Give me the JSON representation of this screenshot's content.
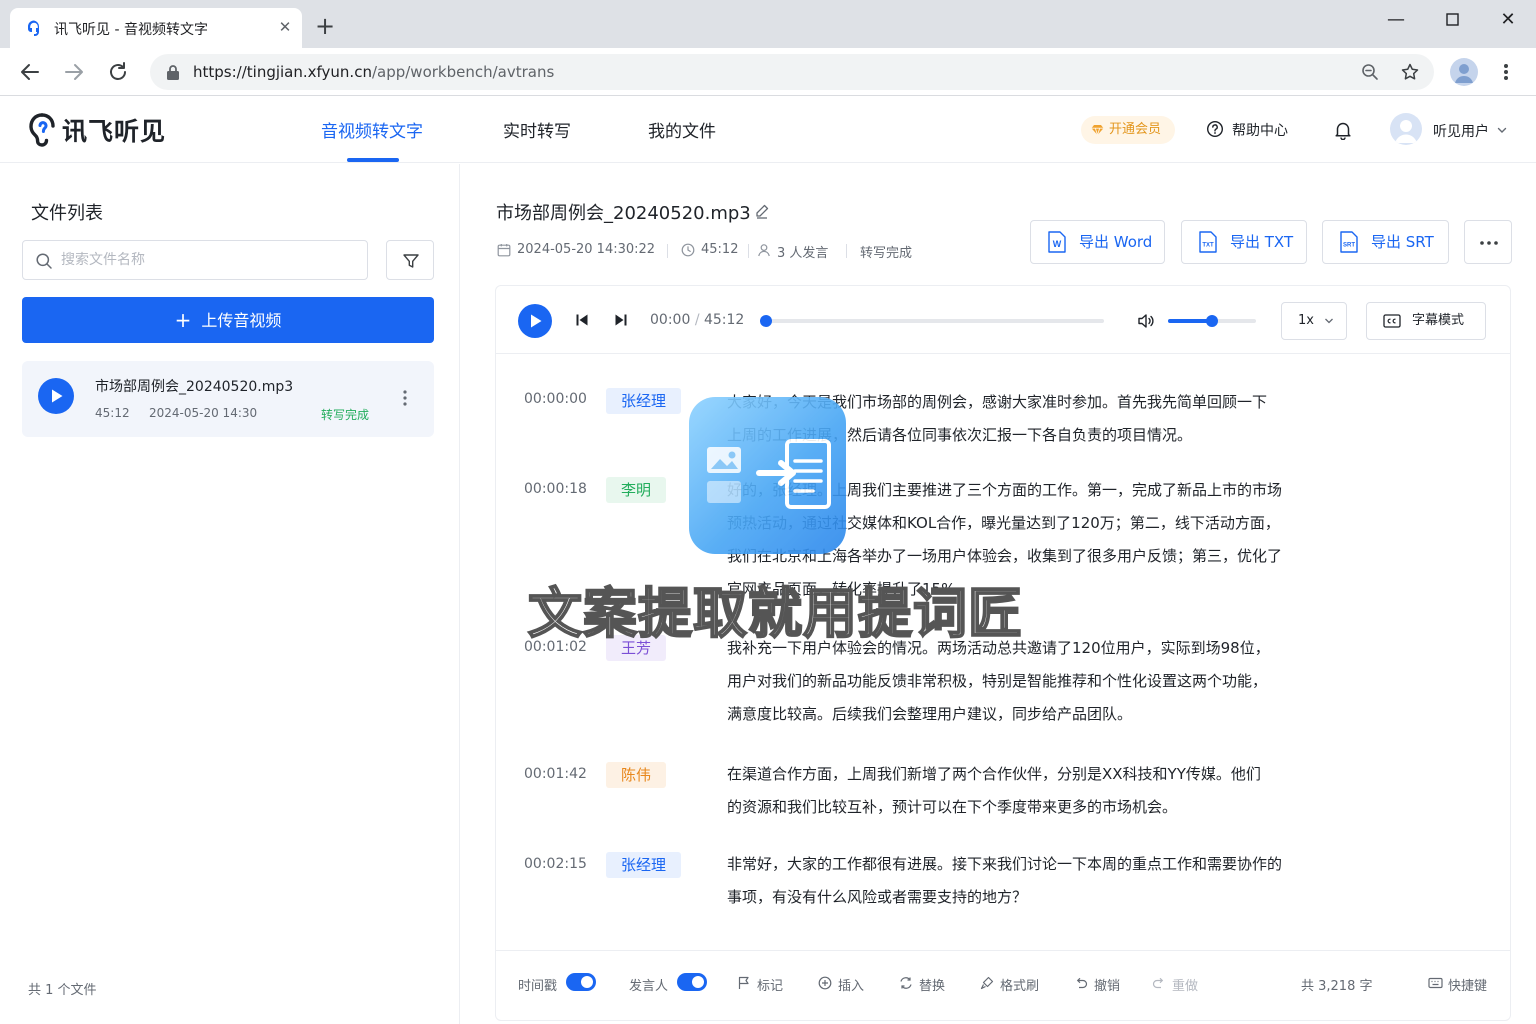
{
  "browser": {
    "tab_title": "讯飞听见 - 音视频转文字",
    "new_tab": "+",
    "url_host": "https://tingjian.xfyun.cn",
    "url_path": "/app/workbench/avtrans"
  },
  "header": {
    "logo": "讯飞听见",
    "nav": [
      "音视频转文字",
      "实时转写",
      "我的文件"
    ],
    "vip": "开通会员",
    "help": "帮助中心",
    "username": "听见用户"
  },
  "sidebar": {
    "title": "文件列表",
    "search_placeholder": "搜索文件名称",
    "upload": "上传音视频",
    "files": [
      {
        "name": "市场部周例会_20240520.mp3",
        "duration": "45:12",
        "date": "2024-05-20 14:30",
        "status": "转写完成"
      }
    ],
    "count": "共 1 个文件"
  },
  "document": {
    "title": "市场部周例会_20240520.mp3",
    "created": "2024-05-20 14:30:22",
    "duration": "45:12",
    "speakers": "3 人发言",
    "status": "转写完成",
    "exports": [
      "导出 Word",
      "导出 TXT",
      "导出 SRT"
    ]
  },
  "player": {
    "current": "00:00",
    "total": "45:12",
    "time_sep": "/",
    "progress": 0.0,
    "volume": 0.5,
    "speed": "1x",
    "subtitle_mode": "字幕模式"
  },
  "transcript": [
    {
      "time": "00:00:00",
      "speaker": "张经理",
      "color": "#1a66f2",
      "bg": "#e8f0fe",
      "lines": [
        "大家好，今天是我们市场部的周例会，感谢大家准时参加。首先我先简单回顾一下",
        "上周的工作进展，然后请各位同事依次汇报一下各自负责的项目情况。"
      ]
    },
    {
      "time": "00:00:18",
      "speaker": "李明",
      "color": "#22ad5c",
      "bg": "#e8f7ee",
      "lines": [
        "好的，张经理。上周我们主要推进了三个方面的工作。第一，完成了新品上市的市场",
        "预热活动，通过社交媒体和KOL合作，曝光量达到了120万；第二，线下活动方面，",
        "我们在北京和上海各举办了一场用户体验会，收集到了很多用户反馈；第三，优化了",
        "官网产品页面，转化率提升了15%。"
      ]
    },
    {
      "time": "00:01:02",
      "speaker": "王芳",
      "color": "#7b4fd6",
      "bg": "#f1ecfb",
      "lines": [
        "我补充一下用户体验会的情况。两场活动总共邀请了120位用户，实际到场98位，",
        "用户对我们的新品功能反馈非常积极，特别是智能推荐和个性化设置这两个功能，",
        "满意度比较高。后续我们会整理用户建议，同步给产品团队。"
      ]
    },
    {
      "time": "00:01:42",
      "speaker": "陈伟",
      "color": "#e8871c",
      "bg": "#fdf1e4",
      "lines": [
        "在渠道合作方面，上周我们新增了两个合作伙伴，分别是XX科技和YY传媒。他们",
        "的资源和我们比较互补，预计可以在下个季度带来更多的市场机会。"
      ]
    },
    {
      "time": "00:02:15",
      "speaker": "张经理",
      "color": "#1a66f2",
      "bg": "#e8f0fe",
      "lines": [
        "非常好，大家的工作都很有进展。接下来我们讨论一下本周的重点工作和需要协作的",
        "事项，有没有什么风险或者需要支持的地方？"
      ]
    }
  ],
  "bottom": {
    "timestamp": "时间戳",
    "speaker": "发言人",
    "mark": "标记",
    "insert": "插入",
    "replace": "替换",
    "format": "格式刷",
    "undo": "撤销",
    "redo": "重做",
    "word_count": "共 3,218 字",
    "shortcuts": "快捷键"
  },
  "watermark": "文案提取就用提词匠",
  "colors": {
    "primary": "#1a66f2",
    "success": "#22ad5c",
    "vip": "#e3961d"
  }
}
